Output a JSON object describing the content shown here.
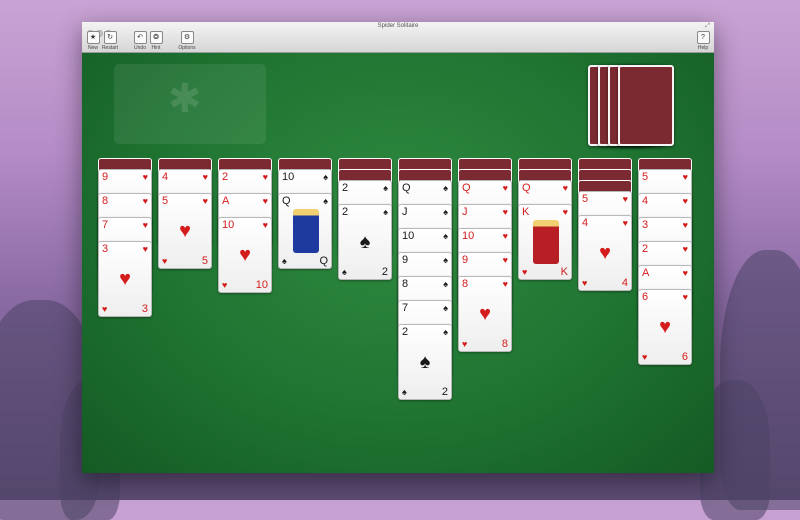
{
  "window": {
    "title": "Spider Solitaire"
  },
  "toolbar": {
    "items": [
      {
        "label": "New",
        "icon": "★"
      },
      {
        "label": "Restart",
        "icon": "↻"
      },
      {
        "label": "Undo",
        "icon": "↶"
      },
      {
        "label": "Hint",
        "icon": "❂"
      },
      {
        "label": "Options",
        "icon": "⚙"
      }
    ],
    "help": {
      "label": "Help",
      "icon": "?"
    }
  },
  "colors": {
    "felt": "#1f7431",
    "card_back": "#7b2a32",
    "red_suit": "#d41c1c"
  },
  "stock": {
    "remaining_deals": 4
  },
  "tableau": [
    {
      "down": 1,
      "cards": [
        [
          "9",
          "♥"
        ],
        [
          "8",
          "♥"
        ],
        [
          "7",
          "♥"
        ],
        [
          "3",
          "♥"
        ]
      ]
    },
    {
      "down": 1,
      "cards": [
        [
          "4",
          "♥"
        ],
        [
          "5",
          "♥"
        ]
      ]
    },
    {
      "down": 1,
      "cards": [
        [
          "2",
          "♥"
        ],
        [
          "A",
          "♥"
        ],
        [
          "10",
          "♥"
        ]
      ]
    },
    {
      "down": 1,
      "cards": [
        [
          "10",
          "♠"
        ],
        [
          "Q",
          "♠"
        ]
      ]
    },
    {
      "down": 2,
      "cards": [
        [
          "2",
          "♠"
        ],
        [
          "2",
          "♠"
        ]
      ]
    },
    {
      "down": 2,
      "cards": [
        [
          "Q",
          "♠"
        ],
        [
          "J",
          "♠"
        ],
        [
          "10",
          "♠"
        ],
        [
          "9",
          "♠"
        ],
        [
          "8",
          "♠"
        ],
        [
          "7",
          "♠"
        ],
        [
          "2",
          "♠"
        ]
      ]
    },
    {
      "down": 2,
      "cards": [
        [
          "Q",
          "♥"
        ],
        [
          "J",
          "♥"
        ],
        [
          "10",
          "♥"
        ],
        [
          "9",
          "♥"
        ],
        [
          "8",
          "♥"
        ]
      ]
    },
    {
      "down": 2,
      "cards": [
        [
          "Q",
          "♥"
        ],
        [
          "K",
          "♥"
        ]
      ]
    },
    {
      "down": 3,
      "cards": [
        [
          "5",
          "♥"
        ],
        [
          "4",
          "♥"
        ]
      ]
    },
    {
      "down": 1,
      "cards": [
        [
          "5",
          "♥"
        ],
        [
          "4",
          "♥"
        ],
        [
          "3",
          "♥"
        ],
        [
          "2",
          "♥"
        ],
        [
          "A",
          "♥"
        ],
        [
          "6",
          "♥"
        ]
      ]
    }
  ]
}
